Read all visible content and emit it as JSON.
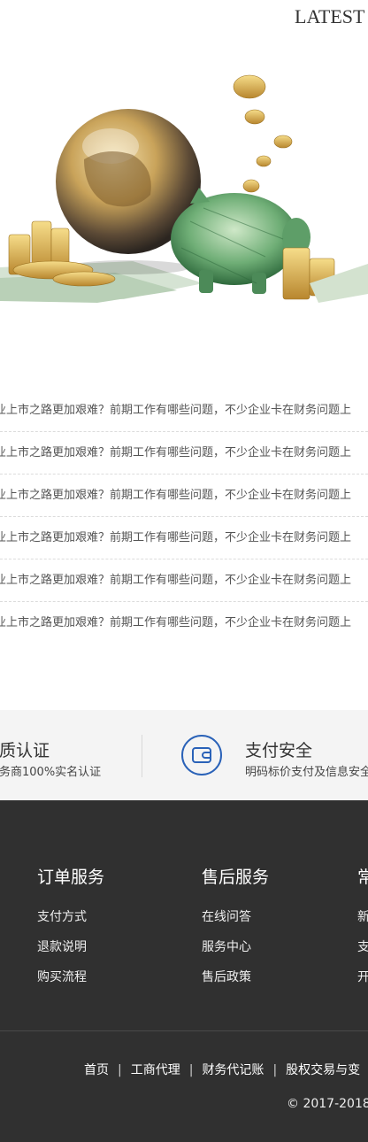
{
  "header": {
    "latest_label": "LATEST"
  },
  "news": {
    "items": [
      "业上市之路更加艰难？前期工作有哪些问题，不少企业卡在财务问题上",
      "业上市之路更加艰难？前期工作有哪些问题，不少企业卡在财务问题上",
      "业上市之路更加艰难？前期工作有哪些问题，不少企业卡在财务问题上",
      "业上市之路更加艰难？前期工作有哪些问题，不少企业卡在财务问题上",
      "业上市之路更加艰难？前期工作有哪些问题，不少企业卡在财务问题上",
      "业上市之路更加艰难？前期工作有哪些问题，不少企业卡在财务问题上"
    ]
  },
  "features": {
    "left_title": "质认证",
    "left_sub": "务商100%实名认证",
    "right_title": "支付安全",
    "right_sub": "明码标价支付及信息安全",
    "right_icon": "wallet-icon"
  },
  "footer": {
    "columns": [
      {
        "title": "订单服务",
        "links": [
          "支付方式",
          "退款说明",
          "购买流程"
        ]
      },
      {
        "title": "售后服务",
        "links": [
          "在线问答",
          "服务中心",
          "售后政策"
        ]
      },
      {
        "title": "常",
        "links": [
          "新",
          "支",
          "开"
        ]
      }
    ],
    "bottom_nav": [
      "首页",
      "工商代理",
      "财务代记账",
      "股权交易与变"
    ],
    "copyright": "© 2017-2018"
  }
}
